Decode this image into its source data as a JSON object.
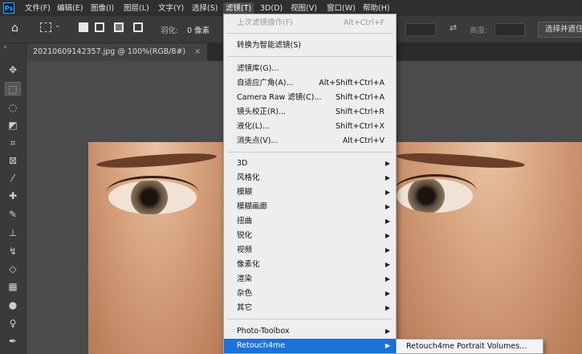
{
  "app": {
    "logo_text": "Ps"
  },
  "menubar": {
    "items": [
      "文件(F)",
      "编辑(E)",
      "图像(I)",
      "图层(L)",
      "文字(Y)",
      "选择(S)",
      "滤镜(T)",
      "3D(D)",
      "视图(V)",
      "窗口(W)",
      "帮助(H)"
    ],
    "active_index": 6
  },
  "options_bar": {
    "feather_label": "羽化:",
    "feather_value": "0 像素",
    "height_label": "高度:",
    "select_mask_button": "选择并遮住..."
  },
  "document": {
    "tab_title": "20210609142357.jpg @ 100%(RGB/8#)",
    "close_symbol": "×"
  },
  "filter_menu": {
    "last_filter": {
      "label": "上次滤镜操作(F)",
      "shortcut": "Alt+Ctrl+F"
    },
    "convert_smart": {
      "label": "转换为智能滤镜(S)"
    },
    "group2": [
      {
        "label": "滤镜库(G)...",
        "shortcut": ""
      },
      {
        "label": "自适应广角(A)...",
        "shortcut": "Alt+Shift+Ctrl+A"
      },
      {
        "label": "Camera Raw 滤镜(C)...",
        "shortcut": "Shift+Ctrl+A"
      },
      {
        "label": "镜头校正(R)...",
        "shortcut": "Shift+Ctrl+R"
      },
      {
        "label": "液化(L)...",
        "shortcut": "Shift+Ctrl+X"
      },
      {
        "label": "消失点(V)...",
        "shortcut": "Alt+Ctrl+V"
      }
    ],
    "submenus": [
      "3D",
      "风格化",
      "模糊",
      "模糊画廊",
      "扭曲",
      "锐化",
      "视频",
      "像素化",
      "渲染",
      "杂色",
      "其它"
    ],
    "plugins": [
      "Photo-Toolbox",
      "Retouch4me"
    ],
    "highlighted": "Retouch4me",
    "arrow_symbol": "▶"
  },
  "retouch_submenu": {
    "items": [
      "Retouch4me Portrait Volumes..."
    ]
  },
  "colors": {
    "highlight": "#1a73d9",
    "menu_bg": "#eeeeee",
    "chrome_dark": "#2f2f2f"
  }
}
